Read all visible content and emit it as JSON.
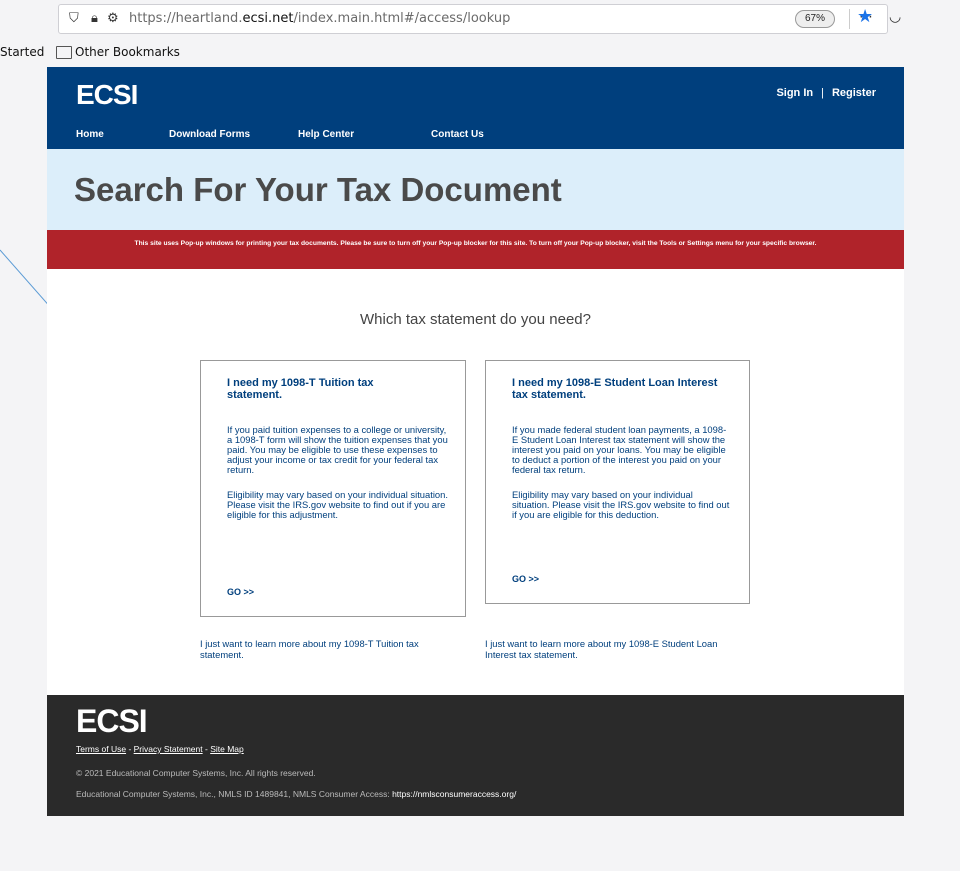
{
  "browser": {
    "url_prefix": "https://heartland.",
    "url_domain": "ecsi.net",
    "url_path": "/index.main.html#/access/lookup",
    "zoom": "67%",
    "bookmarks": [
      "Started",
      "Other Bookmarks"
    ]
  },
  "header": {
    "logo": "ECSI",
    "sign_in": "Sign In",
    "separator": "|",
    "register": "Register",
    "nav": [
      "Home",
      "Download Forms",
      "Help Center",
      "Contact Us"
    ]
  },
  "page": {
    "title": "Search For Your Tax Document",
    "alert": "This site uses Pop-up windows for printing your tax documents. Please be sure to turn off your Pop-up blocker for this site. To turn off your Pop-up blocker, visit the Tools or Settings menu for your specific browser.",
    "question": "Which tax statement do you need?"
  },
  "cards": [
    {
      "title": "I need my 1098-T Tuition tax statement.",
      "body1": "If you paid tuition expenses to a college or university, a 1098-T form will show the tuition expenses that you paid. You may be eligible to use these expenses to adjust your income or tax credit for your federal tax return.",
      "body2": "Eligibility may vary based on your individual situation. Please visit the IRS.gov website to find out if you are eligible for this adjustment.",
      "go": "GO >>",
      "learn": "I just want to learn more about my 1098-T Tuition tax statement."
    },
    {
      "title": "I need my 1098-E Student Loan Interest tax statement.",
      "body1": "If you made federal student loan payments, a 1098-E Student Loan Interest tax statement will show the interest you paid on your loans. You may be eligible to deduct a portion of the interest you paid on your federal tax return.",
      "body2": "Eligibility may vary based on your individual situation. Please visit the IRS.gov website to find out if you are eligible for this deduction.",
      "go": "GO >>",
      "learn": "I just want to learn more about my 1098-E Student Loan Interest tax statement."
    }
  ],
  "footer": {
    "logo": "ECSI",
    "terms": "Terms of Use",
    "dash1": " - ",
    "privacy": "Privacy Statement",
    "dash2": " - ",
    "sitemap": "Site Map",
    "copyright": "© 2021 Educational Computer Systems, Inc. All rights reserved.",
    "nmls": "Educational Computer Systems, Inc., NMLS ID 1489841, NMLS Consumer Access: ",
    "nmls_link": "https://nmlsconsumeraccess.org/"
  },
  "colors": {
    "header_bg": "#003f7d",
    "title_band": "#dceefa",
    "alert_bg": "#b0232a",
    "footer_bg": "#2a2a2a",
    "link": "#003f7d"
  }
}
